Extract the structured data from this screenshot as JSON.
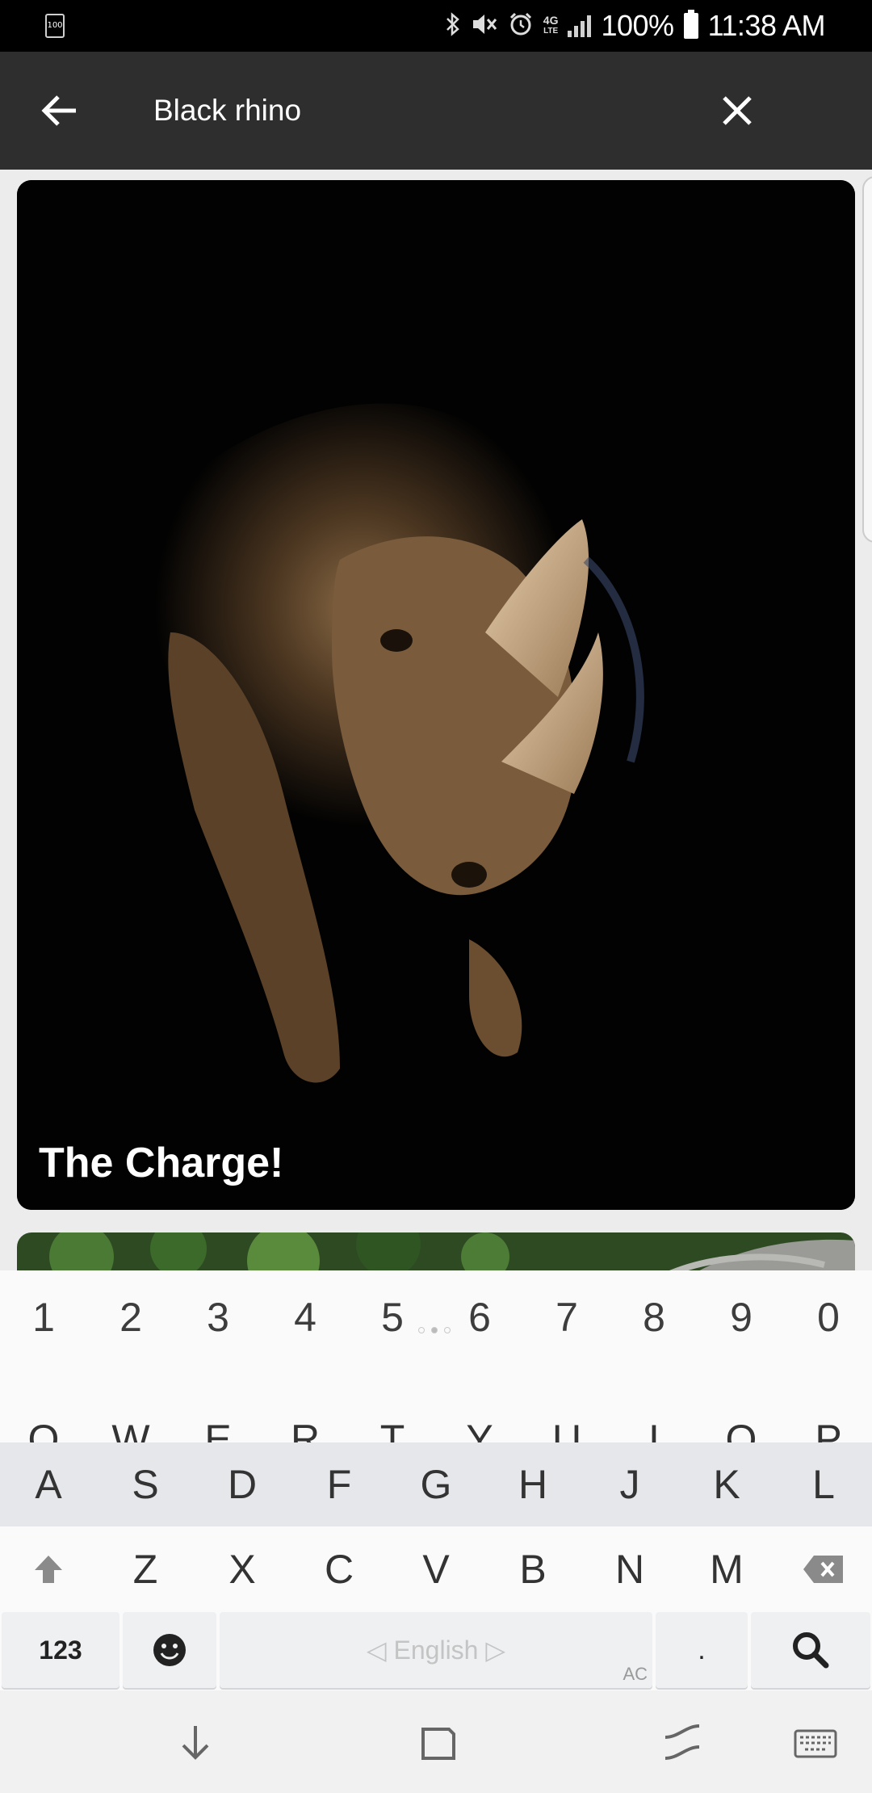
{
  "status_bar": {
    "notification_battery": "100",
    "battery_percent": "100%",
    "time": "11:38 AM",
    "network": "4G",
    "network_sub": "LTE",
    "icons": [
      "bluetooth-icon",
      "mute-icon",
      "alarm-icon",
      "lte-icon",
      "signal-icon",
      "battery-icon"
    ]
  },
  "toolbar": {
    "search_value": "Black rhino",
    "back_icon": "arrow-left-icon",
    "clear_icon": "close-icon"
  },
  "results": {
    "cards": [
      {
        "title": "The Charge!",
        "image": "black rhino head photo"
      }
    ]
  },
  "keyboard": {
    "number_row": [
      "1",
      "2",
      "3",
      "4",
      "5",
      "6",
      "7",
      "8",
      "9",
      "0"
    ],
    "row_q": [
      "Q",
      "W",
      "E",
      "R",
      "T",
      "Y",
      "U",
      "I",
      "O",
      "P"
    ],
    "row_a": [
      "A",
      "S",
      "D",
      "F",
      "G",
      "H",
      "J",
      "K",
      "L"
    ],
    "row_z": [
      "Z",
      "X",
      "C",
      "V",
      "B",
      "N",
      "M"
    ],
    "symbols_key": "123",
    "space_label": "◁ English ▷",
    "ac_label": "AC",
    "period_key": ".",
    "search_key_icon": "search-icon"
  },
  "nav_bar": {
    "buttons": [
      "hide-keyboard-icon",
      "recents-icon",
      "back-icon",
      "keyboard-icon"
    ]
  }
}
